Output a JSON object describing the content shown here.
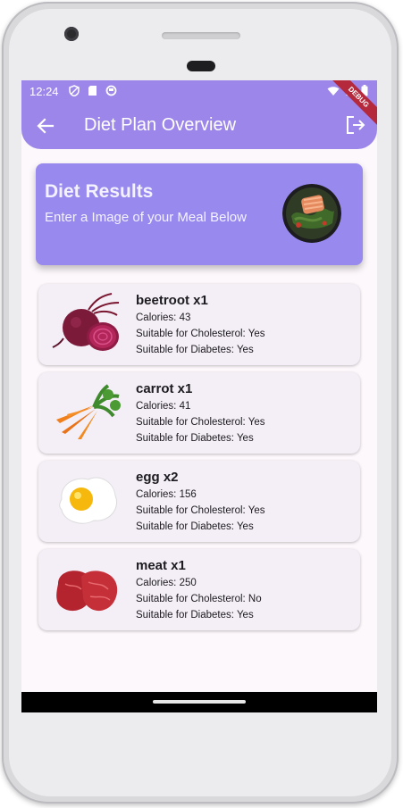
{
  "status_bar": {
    "time": "12:24",
    "ribbon": "DEBUG"
  },
  "app_bar": {
    "title": "Diet Plan Overview"
  },
  "results": {
    "title": "Diet Results",
    "subtitle": "Enter a Image of your Meal Below"
  },
  "foods": [
    {
      "name": "beetroot x1",
      "calories": "Calories: 43",
      "cholesterol": "Suitable for Cholesterol: Yes",
      "diabetes": "Suitable for Diabetes: Yes"
    },
    {
      "name": "carrot x1",
      "calories": "Calories: 41",
      "cholesterol": "Suitable for Cholesterol: Yes",
      "diabetes": "Suitable for Diabetes: Yes"
    },
    {
      "name": "egg x2",
      "calories": "Calories: 156",
      "cholesterol": "Suitable for Cholesterol: Yes",
      "diabetes": "Suitable for Diabetes: Yes"
    },
    {
      "name": "meat x1",
      "calories": "Calories: 250",
      "cholesterol": "Suitable for Cholesterol: No",
      "diabetes": "Suitable for Diabetes: Yes"
    }
  ],
  "colors": {
    "app_bar": "#9c86ea",
    "results_card": "#9789ee",
    "food_card": "#f4eef6"
  }
}
